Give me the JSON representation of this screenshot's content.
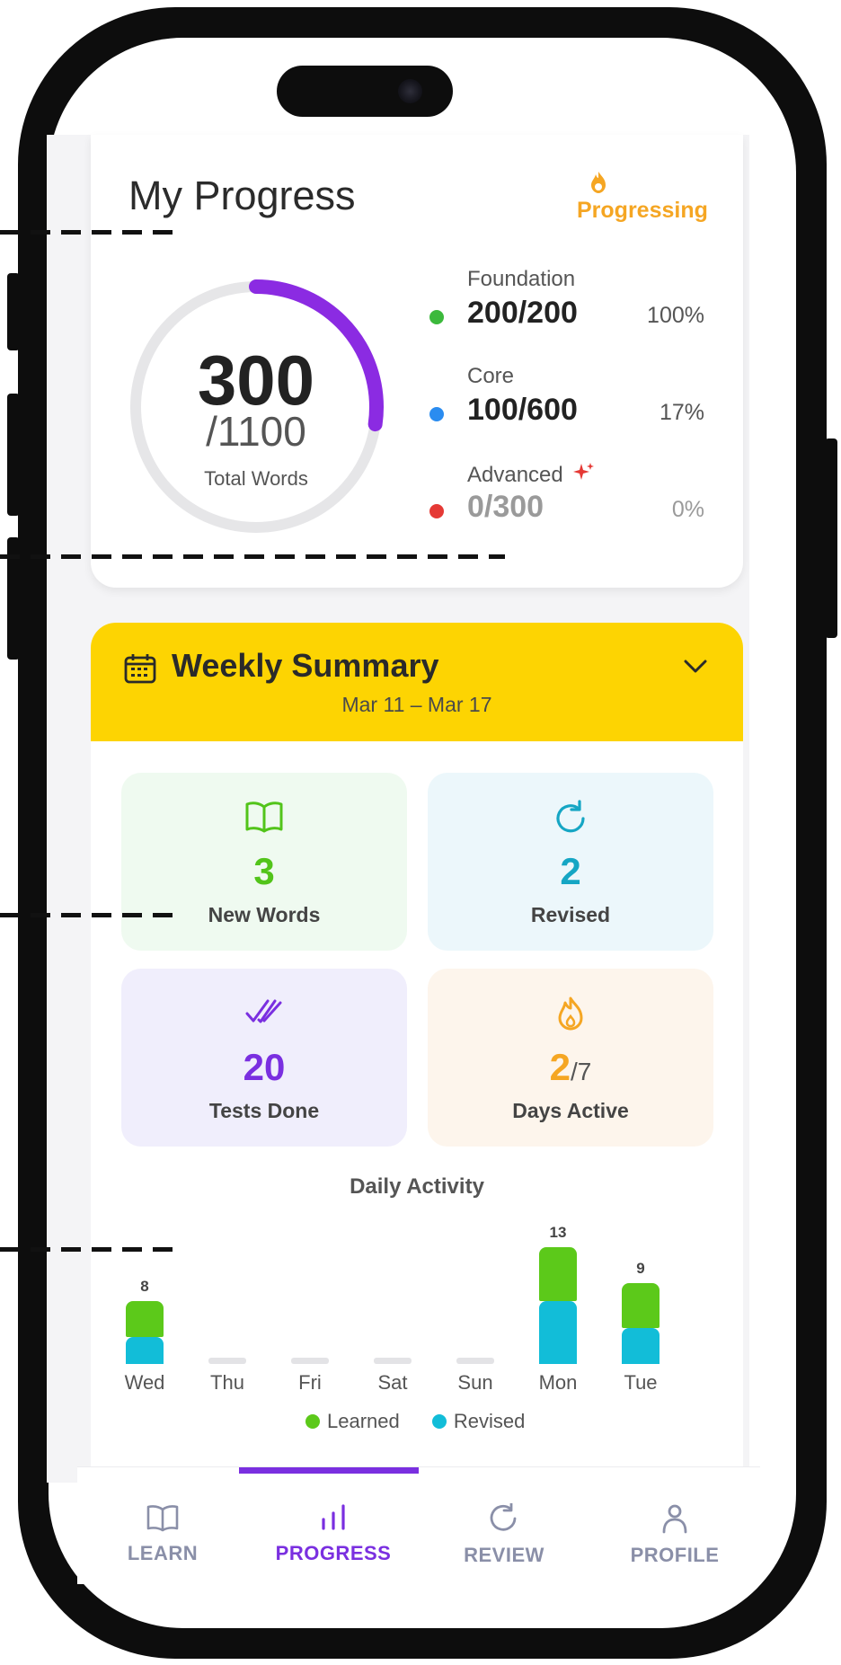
{
  "header": {
    "title": "My Progress",
    "badge_label": "Progressing"
  },
  "summary": {
    "total_learned": "300",
    "total_words": "/1100",
    "caption": "Total Words",
    "progress_fraction": 0.2727
  },
  "levels": [
    {
      "name": "Foundation",
      "count": "200/200",
      "percent": "100%",
      "color": "#3cb93c"
    },
    {
      "name": "Core",
      "count": "100/600",
      "percent": "17%",
      "color": "#2a8cf0"
    },
    {
      "name": "Advanced",
      "count": "0/300",
      "percent": "0%",
      "color": "#e53935"
    }
  ],
  "weekly": {
    "title": "Weekly Summary",
    "range": "Mar 11 – Mar 17",
    "stats": [
      {
        "icon": "open-book-icon",
        "value": "3",
        "label": "New Words",
        "color": "#52c41a",
        "bg": "#effaf0"
      },
      {
        "icon": "refresh-icon",
        "value": "2",
        "label": "Revised",
        "color": "#15a6c4",
        "bg": "#ecf7fb"
      },
      {
        "icon": "double-check-icon",
        "value": "20",
        "label": "Tests Done",
        "color": "#7a2fe0",
        "bg": "#f0eefc"
      },
      {
        "icon": "flame-icon",
        "value": "2",
        "suffix": "/7",
        "label": "Days Active",
        "color": "#f5a623",
        "bg": "#fdf5ec"
      }
    ]
  },
  "daily": {
    "title": "Daily Activity",
    "legend": {
      "learned": "Learned",
      "revised": "Revised"
    }
  },
  "chart_data": {
    "type": "bar",
    "categories": [
      "Wed",
      "Thu",
      "Fri",
      "Sat",
      "Sun",
      "Mon",
      "Tue"
    ],
    "totals": [
      "8",
      "",
      "",
      "",
      "",
      "13",
      "9"
    ],
    "series": [
      {
        "name": "Learned",
        "values": [
          4,
          0,
          0,
          0,
          0,
          6,
          5
        ],
        "color": "#5cc91a"
      },
      {
        "name": "Revised",
        "values": [
          3,
          0,
          0,
          0,
          0,
          7,
          4
        ],
        "color": "#12bdd8"
      }
    ]
  },
  "tabs": [
    {
      "label": "LEARN",
      "icon": "book-icon",
      "active": false
    },
    {
      "label": "PROGRESS",
      "icon": "bar-chart-icon",
      "active": true
    },
    {
      "label": "REVIEW",
      "icon": "refresh-icon",
      "active": false
    },
    {
      "label": "PROFILE",
      "icon": "user-icon",
      "active": false
    }
  ]
}
